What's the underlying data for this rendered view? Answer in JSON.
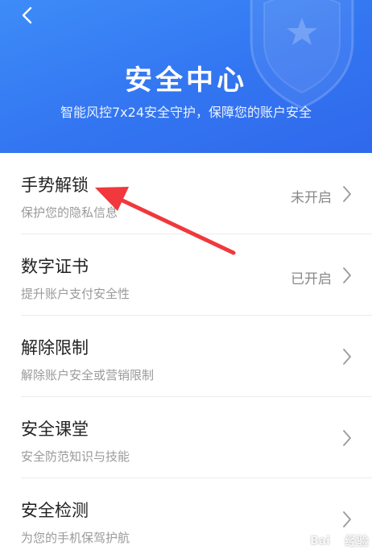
{
  "header": {
    "title": "安全中心",
    "subtitle": "智能风控7x24安全守护，保障您的账户安全"
  },
  "items": [
    {
      "title": "手势解锁",
      "subtitle": "保护您的隐私信息",
      "status": "未开启"
    },
    {
      "title": "数字证书",
      "subtitle": "提升账户支付安全性",
      "status": "已开启"
    },
    {
      "title": "解除限制",
      "subtitle": "解除账户安全或营销限制",
      "status": ""
    },
    {
      "title": "安全课堂",
      "subtitle": "安全防范知识与技能",
      "status": ""
    },
    {
      "title": "安全检测",
      "subtitle": "为您的手机保驾护航",
      "status": ""
    }
  ],
  "watermark": {
    "latin": "Bai",
    "cn": "经验"
  },
  "colors": {
    "header_start": "#3d8cf8",
    "header_end": "#2f69ec",
    "annotation_arrow": "#f0383d"
  },
  "icons": {
    "back": "back-arrow-icon",
    "chevron": "chevron-right-icon",
    "shield": "shield-star-icon",
    "watermark": "paw-icon"
  }
}
